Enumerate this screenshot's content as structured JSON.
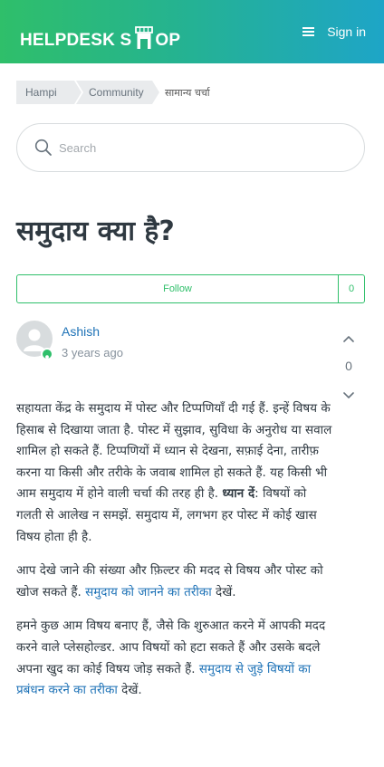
{
  "header": {
    "logo_left": "HELPDESK S",
    "logo_right": "OP",
    "menu_label": "Sign in",
    "colors": {
      "gradient_start": "#2fbf6a",
      "gradient_end": "#1ea5c7"
    }
  },
  "breadcrumb": {
    "items": [
      "Hampi",
      "Community",
      "सामान्य चर्चा"
    ]
  },
  "search": {
    "placeholder": "Search"
  },
  "post": {
    "title": "समुदाय क्या है?",
    "follow_label": "Follow",
    "follower_count": "0",
    "author": "Ashish",
    "time": "3 years ago",
    "vote_count": "0",
    "p1_text": "सहायता केंद्र के समुदाय में पोस्ट और टिप्पणियाँ दी गई हैं. इन्हें विषय के हिसाब से दिखाया जाता है. पोस्ट में सुझाव, सुविधा के अनुरोध या सवाल शामिल हो सकते हैं. टिप्पणियों में ध्यान से देखना, सफ़ाई देना, तारीफ़ करना या किसी और तरीके के जवाब शामिल हो सकते हैं. यह किसी भी आम समुदाय में होने वाली चर्चा की तरह ही है. ",
    "p1_bold": "ध्यान दें",
    "p1_tail": ": विषयों को गलती से आलेख न समझें. समुदाय में, लगभग हर पोस्ट में कोई खास विषय होता ही है.",
    "p2_text": "आप देखे जाने की संख्या और फ़िल्टर की मदद से विषय और पोस्ट को खोज सकते हैं. ",
    "p2_link": "समुदाय को जानने का तरीका",
    "p2_tail": " देखें.",
    "p3_text": "हमने कुछ आम विषय बनाए हैं, जैसे कि शुरुआत करने में आपकी मदद करने वाले प्लेसहोल्डर. आप विषयों को हटा सकते हैं और उसके बदले अपना खुद का कोई विषय जोड़ सकते हैं. ",
    "p3_link": "समुदाय से जुड़े विषयों का प्रबंधन करने का तरीका",
    "p3_tail": " देखें."
  },
  "icons": {
    "store": "storefront-icon",
    "menu": "hamburger-menu-icon",
    "search": "search-icon",
    "user": "user-avatar-icon",
    "badge": "team-member-badge-icon",
    "vote_up": "chevron-up-icon",
    "vote_down": "chevron-down-icon"
  }
}
